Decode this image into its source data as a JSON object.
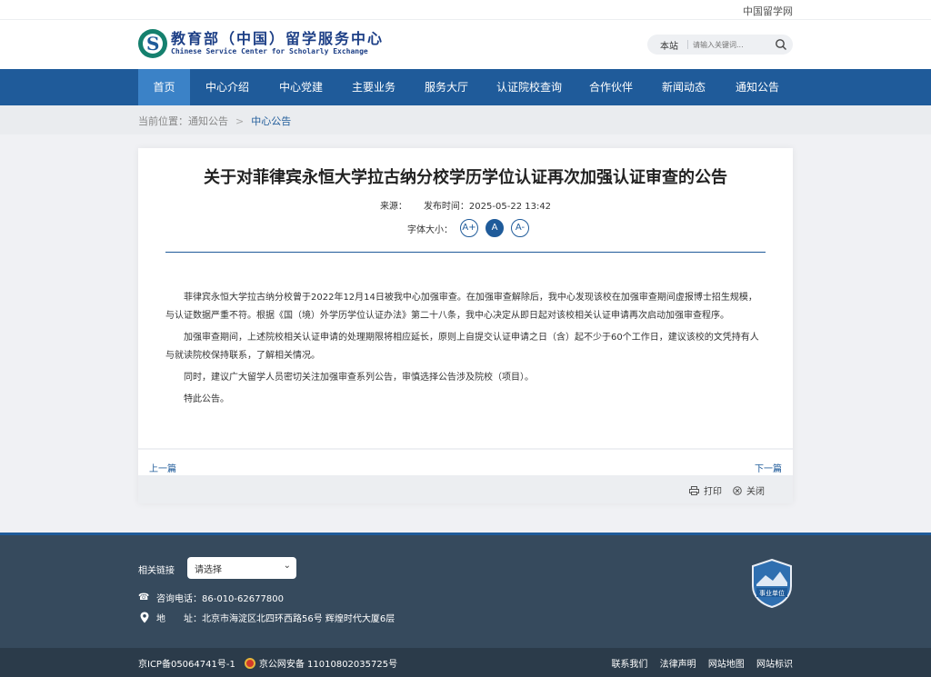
{
  "topbar": {
    "link": "中国留学网"
  },
  "logo": {
    "cn": "教育部（中国）留学服务中心",
    "en": "Chinese Service Center for Scholarly Exchange"
  },
  "search": {
    "scope": "本站",
    "placeholder": "请输入关键词..."
  },
  "nav": [
    {
      "label": "首页"
    },
    {
      "label": "中心介绍"
    },
    {
      "label": "中心党建"
    },
    {
      "label": "主要业务"
    },
    {
      "label": "服务大厅"
    },
    {
      "label": "认证院校查询"
    },
    {
      "label": "合作伙伴"
    },
    {
      "label": "新闻动态"
    },
    {
      "label": "通知公告"
    }
  ],
  "breadcrumb": {
    "prefix": "当前位置：",
    "parent": "通知公告",
    "current": "中心公告"
  },
  "article": {
    "title": "关于对菲律宾永恒大学拉古纳分校学历学位认证再次加强认证审查的公告",
    "source": "来源：",
    "published": "发布时间：2025-05-22 13:42",
    "font_label": "字体大小：",
    "font_buttons": [
      "A+",
      "A",
      "A-"
    ],
    "paragraphs": [
      "菲律宾永恒大学拉古纳分校曾于2022年12月14日被我中心加强审查。在加强审查解除后，我中心发现该校在加强审查期间虚报博士招生规模，与认证数据严重不符。根据《国（境）外学历学位认证办法》第二十八条，我中心决定从即日起对该校相关认证申请再次启动加强审查程序。",
      "加强审查期间，上述院校相关认证申请的处理期限将相应延长，原则上自提交认证申请之日（含）起不少于60个工作日，建议该校的文凭持有人与就读院校保持联系，了解相关情况。",
      "同时，建议广大留学人员密切关注加强审查系列公告，审慎选择公告涉及院校（项目）。",
      "特此公告。"
    ],
    "prev": "上一篇",
    "next": "下一篇",
    "print": "打印",
    "close": "关闭"
  },
  "footer": {
    "links_label": "相关链接",
    "select_value": "请选择",
    "phone": "咨询电话：86-010-62677800",
    "address_label": "地　　址：",
    "address": "北京市海淀区北四环西路56号 辉煌时代大厦6层",
    "badge": "事业单位",
    "icp": "京ICP备05064741号-1",
    "police": "京公网安备 11010802035725号",
    "bottom_links": [
      "联系我们",
      "法律声明",
      "网站地图",
      "网站标识"
    ]
  },
  "colors": {
    "brand": "#1f5b9a",
    "nav_active": "#3b82c7",
    "footer": "#364a5d"
  }
}
